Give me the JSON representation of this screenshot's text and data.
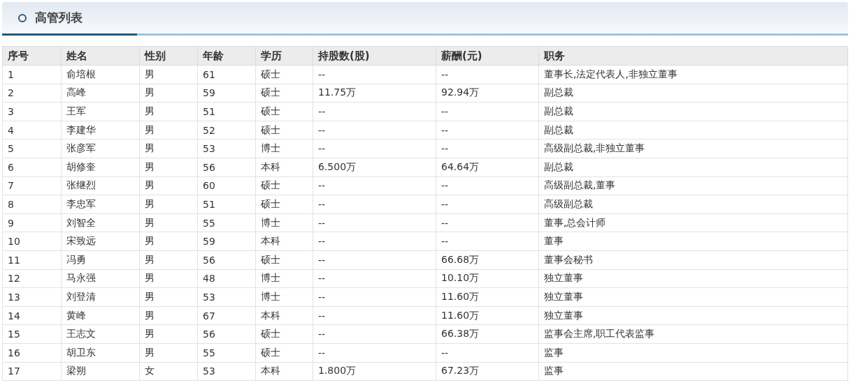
{
  "panel": {
    "title": "高管列表"
  },
  "table": {
    "columns": [
      "序号",
      "姓名",
      "性别",
      "年龄",
      "学历",
      "持股数(股)",
      "薪酬(元)",
      "职务"
    ],
    "rows": [
      [
        "1",
        "俞培根",
        "男",
        "61",
        "硕士",
        "--",
        "--",
        "董事长,法定代表人,非独立董事"
      ],
      [
        "2",
        "高峰",
        "男",
        "59",
        "硕士",
        "11.75万",
        "92.94万",
        "副总裁"
      ],
      [
        "3",
        "王军",
        "男",
        "51",
        "硕士",
        "--",
        "--",
        "副总裁"
      ],
      [
        "4",
        "李建华",
        "男",
        "52",
        "硕士",
        "--",
        "--",
        "副总裁"
      ],
      [
        "5",
        "张彦军",
        "男",
        "53",
        "博士",
        "--",
        "--",
        "高级副总裁,非独立董事"
      ],
      [
        "6",
        "胡修奎",
        "男",
        "56",
        "本科",
        "6.500万",
        "64.64万",
        "副总裁"
      ],
      [
        "7",
        "张继烈",
        "男",
        "60",
        "硕士",
        "--",
        "--",
        "高级副总裁,董事"
      ],
      [
        "8",
        "李忠军",
        "男",
        "51",
        "硕士",
        "--",
        "--",
        "高级副总裁"
      ],
      [
        "9",
        "刘智全",
        "男",
        "55",
        "博士",
        "--",
        "--",
        "董事,总会计师"
      ],
      [
        "10",
        "宋致远",
        "男",
        "59",
        "本科",
        "--",
        "--",
        "董事"
      ],
      [
        "11",
        "冯勇",
        "男",
        "56",
        "硕士",
        "--",
        "66.68万",
        "董事会秘书"
      ],
      [
        "12",
        "马永强",
        "男",
        "48",
        "博士",
        "--",
        "10.10万",
        "独立董事"
      ],
      [
        "13",
        "刘登清",
        "男",
        "53",
        "博士",
        "--",
        "11.60万",
        "独立董事"
      ],
      [
        "14",
        "黄峰",
        "男",
        "67",
        "本科",
        "--",
        "11.60万",
        "独立董事"
      ],
      [
        "15",
        "王志文",
        "男",
        "56",
        "硕士",
        "--",
        "66.38万",
        "监事会主席,职工代表监事"
      ],
      [
        "16",
        "胡卫东",
        "男",
        "55",
        "硕士",
        "--",
        "--",
        "监事"
      ],
      [
        "17",
        "梁朔",
        "女",
        "53",
        "本科",
        "1.800万",
        "67.23万",
        "监事"
      ]
    ]
  }
}
